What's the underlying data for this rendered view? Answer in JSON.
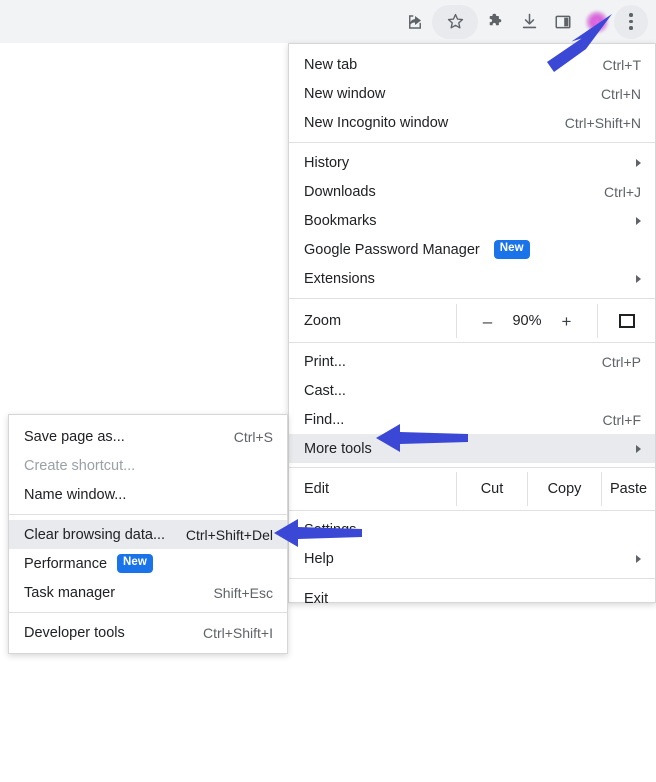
{
  "toolbar": {
    "icons": [
      {
        "name": "share-icon",
        "label": "Share"
      },
      {
        "name": "bookmark-star-icon",
        "label": "Bookmark this tab"
      },
      {
        "name": "extensions-puzzle-icon",
        "label": "Extensions"
      },
      {
        "name": "downloads-icon",
        "label": "Downloads"
      },
      {
        "name": "side-panel-icon",
        "label": "Side panel"
      },
      {
        "name": "profile-avatar",
        "label": "Profile"
      },
      {
        "name": "three-dot-menu-icon",
        "label": "Customize and control Google Chrome"
      }
    ]
  },
  "main_menu": {
    "group1": [
      {
        "label": "New tab",
        "accel": "Ctrl+T"
      },
      {
        "label": "New window",
        "accel": "Ctrl+N"
      },
      {
        "label": "New Incognito window",
        "accel": "Ctrl+Shift+N"
      }
    ],
    "group2": [
      {
        "label": "History",
        "accel": "",
        "submenu": true
      },
      {
        "label": "Downloads",
        "accel": "Ctrl+J",
        "submenu": false
      },
      {
        "label": "Bookmarks",
        "accel": "",
        "submenu": true
      },
      {
        "label": "Google Password Manager",
        "accel": "",
        "submenu": false,
        "badge": "New"
      },
      {
        "label": "Extensions",
        "accel": "",
        "submenu": true
      }
    ],
    "zoom_row": {
      "label": "Zoom",
      "minus": "–",
      "value": "90%",
      "plus": "+",
      "fullscreen_icon": "fullscreen-icon"
    },
    "group3": [
      {
        "label": "Print...",
        "accel": "Ctrl+P"
      },
      {
        "label": "Cast...",
        "accel": ""
      },
      {
        "label": "Find...",
        "accel": "Ctrl+F"
      },
      {
        "label": "More tools",
        "accel": "",
        "submenu": true,
        "highlighted": true
      }
    ],
    "edit_row": {
      "label": "Edit",
      "cut": "Cut",
      "copy": "Copy",
      "paste": "Paste"
    },
    "group4": [
      {
        "label": "Settings",
        "accel": "",
        "submenu": false
      },
      {
        "label": "Help",
        "accel": "",
        "submenu": true
      }
    ],
    "group5": [
      {
        "label": "Exit",
        "accel": ""
      }
    ]
  },
  "more_tools_menu": {
    "group1": [
      {
        "label": "Save page as...",
        "accel": "Ctrl+S",
        "disabled": false
      },
      {
        "label": "Create shortcut...",
        "accel": "",
        "disabled": true
      },
      {
        "label": "Name window...",
        "accel": "",
        "disabled": false
      }
    ],
    "group2": [
      {
        "label": "Clear browsing data...",
        "accel": "Ctrl+Shift+Del",
        "highlighted": true
      },
      {
        "label": "Performance",
        "accel": "",
        "badge": "New"
      },
      {
        "label": "Task manager",
        "accel": "Shift+Esc"
      }
    ],
    "group3": [
      {
        "label": "Developer tools",
        "accel": "Ctrl+Shift+I"
      }
    ]
  },
  "annotations": {
    "arrow_color": "#3b48d6",
    "arrows": [
      {
        "name": "arrow-to-three-dot-menu",
        "points_to": "three-dot-menu-icon"
      },
      {
        "name": "arrow-to-more-tools",
        "points_to": "More tools"
      },
      {
        "name": "arrow-to-clear-browsing-data",
        "points_to": "Clear browsing data..."
      }
    ]
  },
  "colors": {
    "toolbar_bg": "#f1f3f4",
    "menu_bg": "#ffffff",
    "highlight_bg": "#e8eaed",
    "badge_bg": "#1a73e8",
    "text": "#202124",
    "accel_text": "#5f6368",
    "disabled_text": "#9aa0a6"
  }
}
